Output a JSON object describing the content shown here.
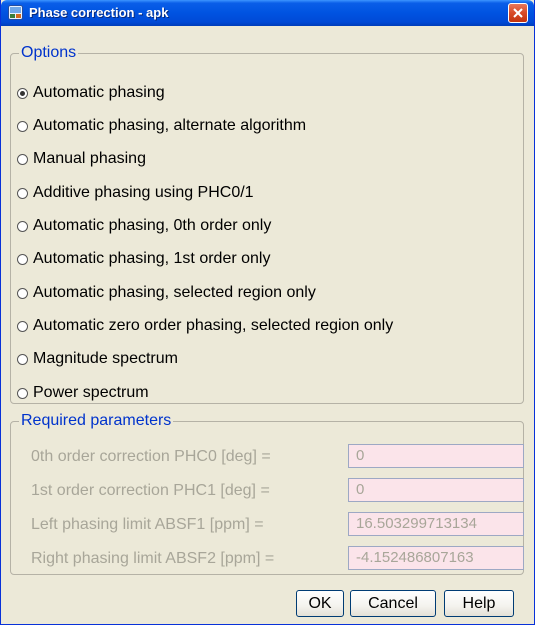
{
  "window": {
    "title": "Phase correction - apk",
    "title_color": "#FFFFFF",
    "titlebar_color": "#0053E1",
    "icon": "app-icon"
  },
  "options": {
    "legend": "Options",
    "selected_index": 0,
    "items": [
      {
        "label": "Automatic phasing",
        "checked": true
      },
      {
        "label": "Automatic phasing, alternate algorithm",
        "checked": false
      },
      {
        "label": "Manual phasing",
        "checked": false
      },
      {
        "label": "Additive phasing using PHC0/1",
        "checked": false
      },
      {
        "label": "Automatic phasing, 0th order only",
        "checked": false
      },
      {
        "label": "Automatic phasing, 1st order only",
        "checked": false
      },
      {
        "label": "Automatic phasing, selected region only",
        "checked": false
      },
      {
        "label": "Automatic zero order phasing, selected region only",
        "checked": false
      },
      {
        "label": "Magnitude spectrum",
        "checked": false
      },
      {
        "label": "Power spectrum",
        "checked": false
      }
    ]
  },
  "params": {
    "legend": "Required parameters",
    "legend_color": "#0033CC",
    "disabled_text_color": "#A8A699",
    "field_bg": "#FBE4EA",
    "rows": [
      {
        "label": "0th order correction PHC0 [deg] =",
        "value": "0"
      },
      {
        "label": "1st order correction PHC1 [deg] =",
        "value": "0"
      },
      {
        "label": "Left phasing limit ABSF1 [ppm] =",
        "value": "16.503299713134"
      },
      {
        "label": "Right phasing limit ABSF2 [ppm] =",
        "value": "-4.152486807163"
      }
    ]
  },
  "buttons": {
    "ok": "OK",
    "cancel": "Cancel",
    "help": "Help"
  }
}
